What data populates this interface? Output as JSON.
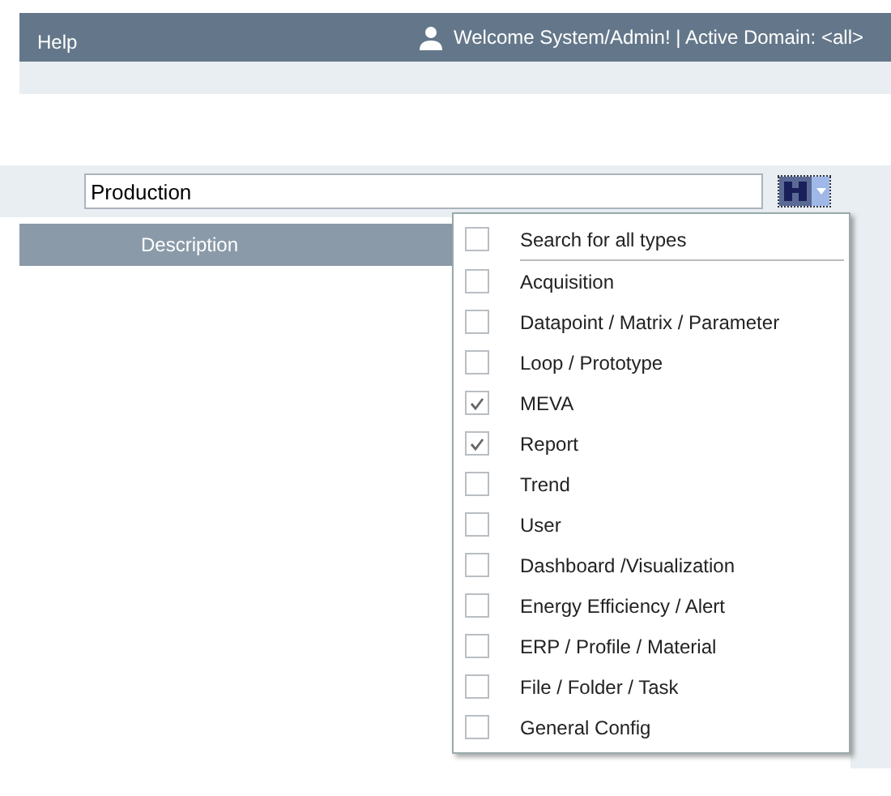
{
  "header": {
    "menu": "Help",
    "welcome": "Welcome System/Admin! | Active Domain: <all>"
  },
  "search": {
    "value": "Production"
  },
  "table": {
    "columns": [
      "Description"
    ]
  },
  "type_menu": {
    "items": [
      {
        "label": "Search for all types",
        "checked": false
      },
      {
        "label": "Acquisition",
        "checked": false
      },
      {
        "label": "Datapoint / Matrix / Parameter",
        "checked": false
      },
      {
        "label": "Loop / Prototype",
        "checked": false
      },
      {
        "label": "MEVA",
        "checked": true
      },
      {
        "label": "Report",
        "checked": true
      },
      {
        "label": "Trend",
        "checked": false
      },
      {
        "label": "User",
        "checked": false
      },
      {
        "label": "Dashboard /Visualization",
        "checked": false
      },
      {
        "label": "Energy Efficiency / Alert",
        "checked": false
      },
      {
        "label": "ERP / Profile / Material",
        "checked": false
      },
      {
        "label": "File / Folder / Task",
        "checked": false
      },
      {
        "label": "General Config",
        "checked": false
      }
    ]
  }
}
